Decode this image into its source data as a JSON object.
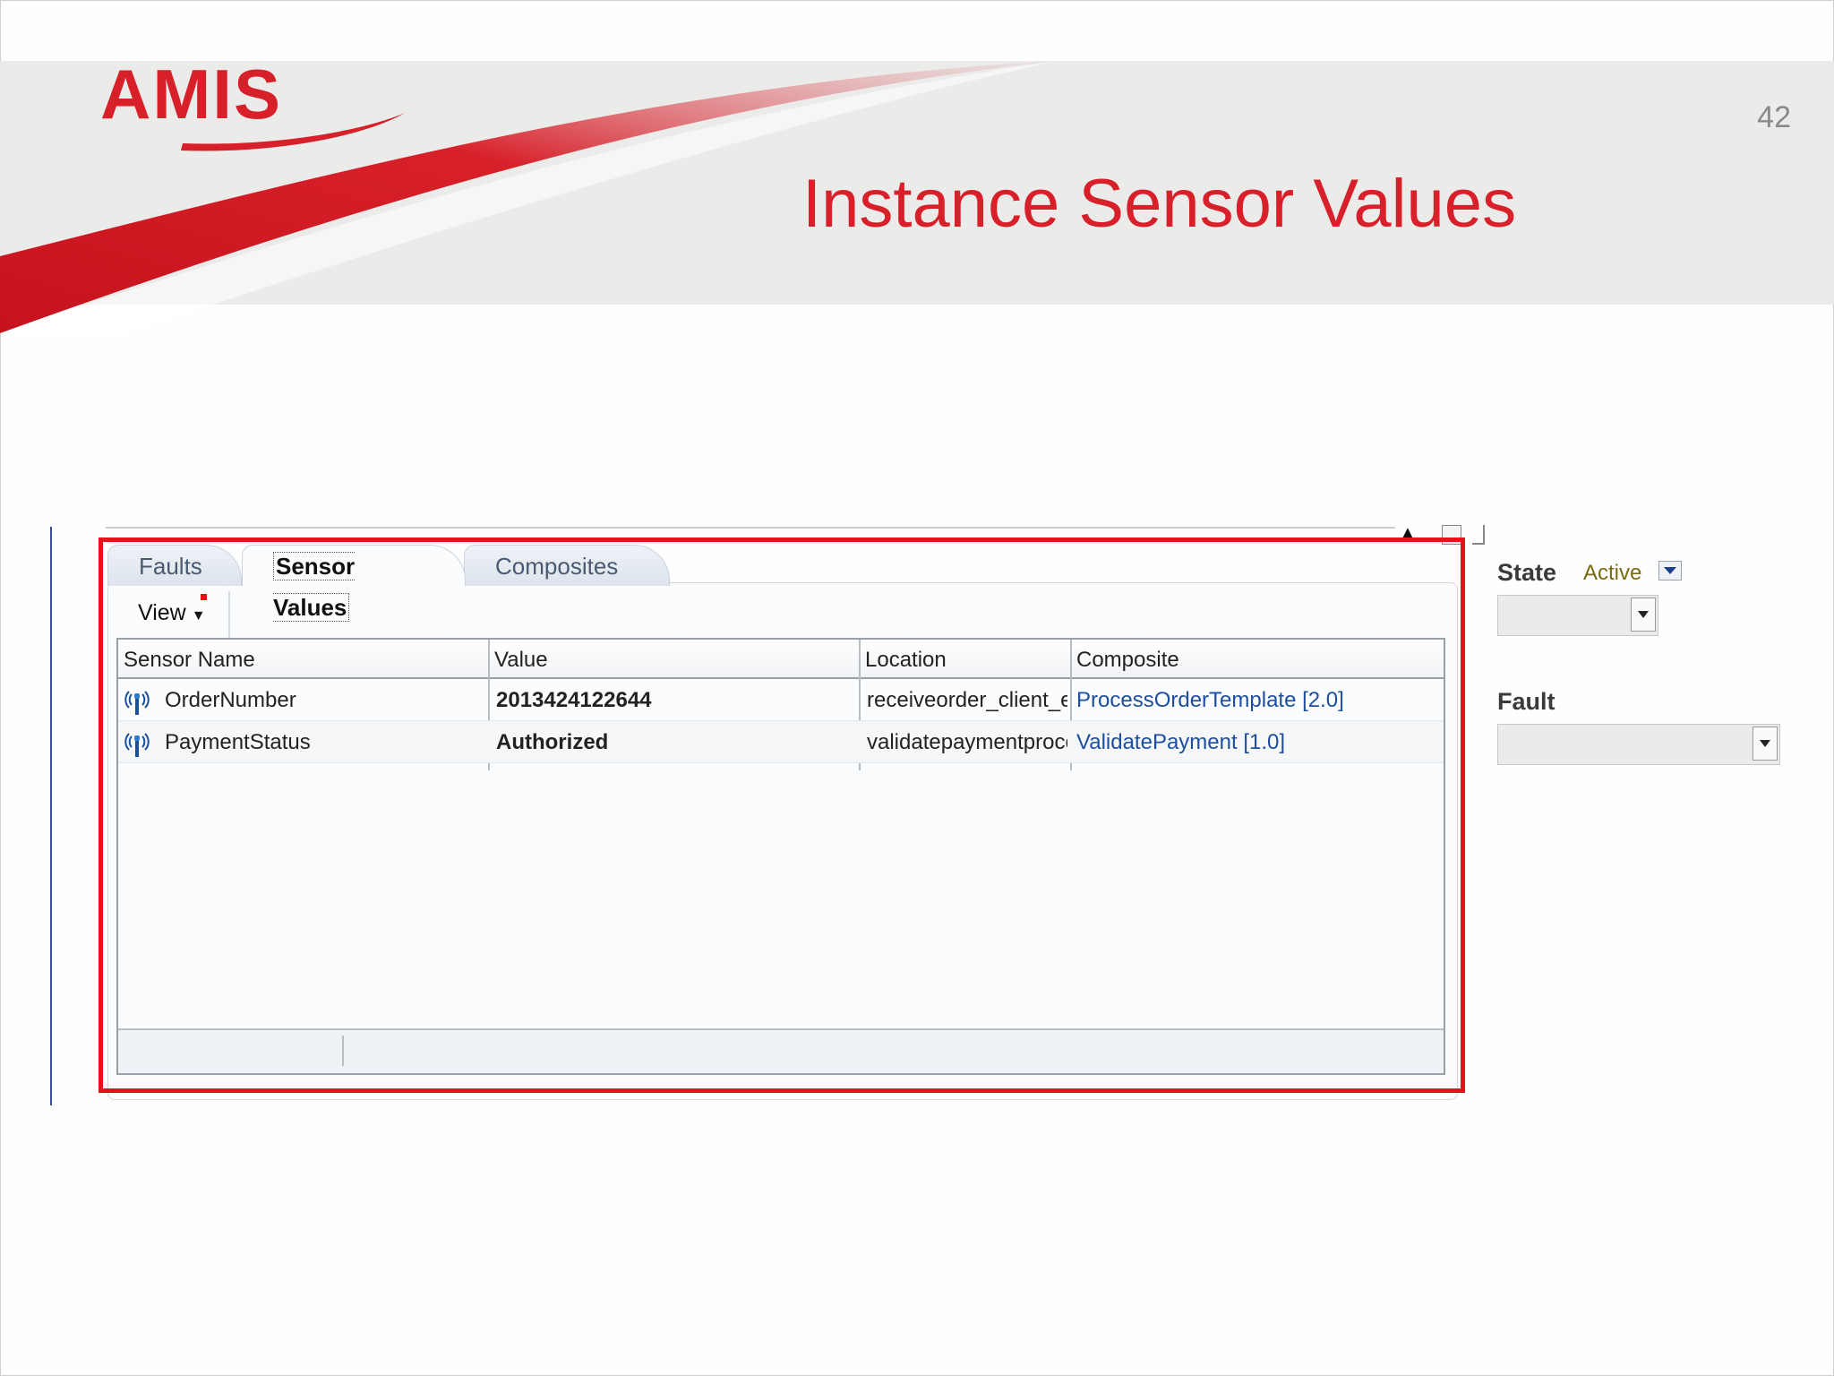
{
  "slide": {
    "logo_text": "AMIS",
    "number": "42",
    "title": "Instance Sensor Values"
  },
  "colors": {
    "brand_red": "#d8202a",
    "link_blue": "#1d4ea0"
  },
  "tabs": [
    {
      "label": "Faults",
      "active": false
    },
    {
      "label": "Sensor Values",
      "active": true
    },
    {
      "label": "Composites",
      "active": false
    }
  ],
  "toolbar": {
    "view_label": "View"
  },
  "table": {
    "columns": [
      "Sensor Name",
      "Value",
      "Location",
      "Composite"
    ],
    "rows": [
      {
        "sensor_name": "OrderNumber",
        "value": "2013424122644",
        "location": "receiveorder_client_e",
        "composite": "ProcessOrderTemplate [2.0]",
        "icon": "sensor-antenna-icon"
      },
      {
        "sensor_name": "PaymentStatus",
        "value": "Authorized",
        "location": "validatepaymentproce",
        "composite": "ValidatePayment [1.0]",
        "icon": "sensor-antenna-icon"
      }
    ]
  },
  "filters": {
    "state_label": "State",
    "state_value": "Active",
    "fault_label": "Fault"
  }
}
